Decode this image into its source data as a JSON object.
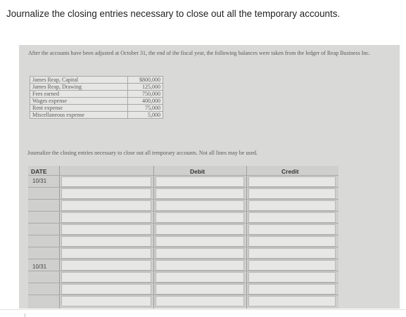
{
  "question": "Journalize the closing entries necessary to close out all the temporary accounts.",
  "photo": {
    "intro": "After the accounts have been adjusted at October 31, the end of the fiscal year, the following balances were taken from the ledger of Reap Business Inc.",
    "balances": [
      {
        "account": "James Reap, Capital",
        "amount": "$800,000"
      },
      {
        "account": "James Reap, Drawing",
        "amount": "125,000"
      },
      {
        "account": "Fees earned",
        "amount": "750,000"
      },
      {
        "account": "Wages expense",
        "amount": "400,000"
      },
      {
        "account": "Rent expense",
        "amount": "75,000"
      },
      {
        "account": "Miscellaneous expense",
        "amount": "5,000"
      }
    ],
    "instructions": "Journalize the closing entries necessary to close out all temporary accounts. Not all lines may be used.",
    "journal": {
      "headers": {
        "date": "DATE",
        "debit": "Debit",
        "credit": "Credit"
      },
      "date_first": "10/31",
      "date_second": "10/31"
    }
  }
}
